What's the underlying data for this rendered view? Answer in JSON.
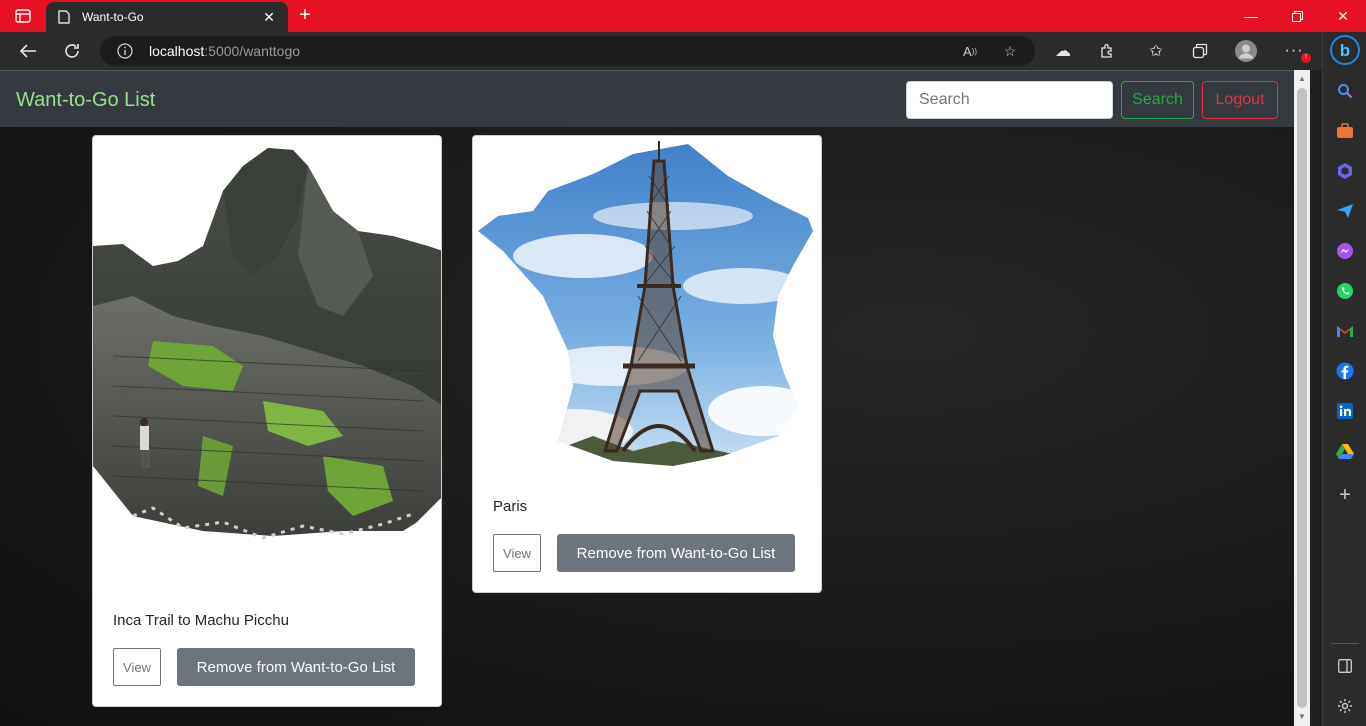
{
  "browser": {
    "tab_title": "Want-to-Go",
    "url_host": "localhost",
    "url_path": ":5000/wanttogo"
  },
  "navbar": {
    "brand": "Want-to-Go List",
    "search_placeholder": "Search",
    "search_button": "Search",
    "logout_button": "Logout"
  },
  "cards": [
    {
      "title": "Inca Trail to Machu Picchu",
      "view_label": "View",
      "remove_label": "Remove from Want-to-Go List"
    },
    {
      "title": "Paris",
      "view_label": "View",
      "remove_label": "Remove from Want-to-Go List"
    }
  ],
  "colors": {
    "titlebar": "#e81123",
    "brand": "#98e08e",
    "navbar": "#343a40",
    "search_btn": "#28a745",
    "logout_btn": "#dc3545",
    "remove_btn": "#6c757d"
  }
}
